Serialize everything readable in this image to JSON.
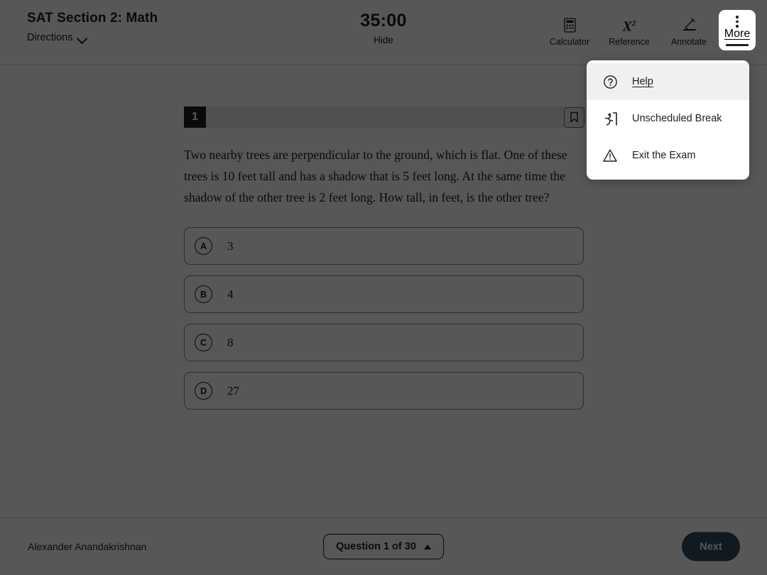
{
  "header": {
    "exam_title": "SAT Section 2: Math",
    "directions_label": "Directions",
    "directions_icon": "chevron-down-icon",
    "timer": {
      "value": "35:00",
      "hide_label": "Hide"
    },
    "tools": [
      {
        "label": "Calculator",
        "icon": "calculator-icon",
        "active": false
      },
      {
        "label": "Reference",
        "icon": "x-squared-icon",
        "active": false
      },
      {
        "label": "Annotate",
        "icon": "highlighter-pen-icon",
        "active": false
      },
      {
        "label": "More",
        "icon": "three-dots-vertical-icon",
        "active": true
      }
    ]
  },
  "more_menu": {
    "items": [
      {
        "label": "Help",
        "icon": "question-circle-icon",
        "hovered": true
      },
      {
        "label": "Unscheduled Break",
        "icon": "running-person-exit-icon",
        "hovered": false
      },
      {
        "label": "Exit the Exam",
        "icon": "warning-triangle-icon",
        "hovered": false
      }
    ]
  },
  "question": {
    "number": "1",
    "bookmark_icon": "bookmark-icon",
    "text": "Two nearby trees are perpendicular to the ground, which is flat. One of these trees is 10 feet tall and has a shadow that is 5 feet long. At the same time the shadow of the other tree is 2 feet long. How tall, in feet, is the other tree?",
    "choices": [
      {
        "letter": "A",
        "text": "3"
      },
      {
        "letter": "B",
        "text": "4"
      },
      {
        "letter": "C",
        "text": "8"
      },
      {
        "letter": "D",
        "text": "27"
      }
    ]
  },
  "footer": {
    "student_name": "Alexander Anandakrishnan",
    "question_nav_label": "Question 1 of 30",
    "question_nav_icon": "caret-up-icon",
    "next_label": "Next"
  },
  "colors": {
    "accent_button": "#324b61",
    "text_primary": "#1e1e1e",
    "question_bar": "#e9e9e9",
    "overlay": "rgba(0,0,0,0.66)",
    "menu_hover": "#f0f0f0"
  }
}
